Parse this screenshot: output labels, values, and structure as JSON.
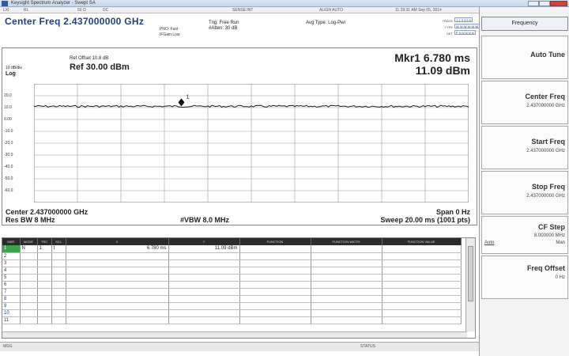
{
  "window": {
    "title": "Keysight Spectrum Analyzer - Swept SA"
  },
  "menubar": {
    "items": [
      "LXI",
      "RL",
      "",
      "50 Ω",
      "DC",
      "SENSE:INT",
      "ALIGN AUTO"
    ]
  },
  "header": {
    "center_freq_title": "Center Freq 2.437000000 GHz",
    "pno": "PNO: Fast",
    "if_gain": "IFGain:Low",
    "trig": "Trig: Free Run",
    "atten": "#Atten: 30 dB",
    "avg_type": "Avg Type: Log-Pwr",
    "timestamp": "11:29:31 AM Sep 05, 2014",
    "trace_label": "TRACE",
    "trace_value": "1 2 3 4 5 6",
    "type_label": "TYPE",
    "type_value": "W W W W W W",
    "det_label": "DET",
    "det_value": "P N N N N N"
  },
  "graph": {
    "ref_offset": "Ref Offset 10.8 dB",
    "ref_level": "Ref 30.00 dBm",
    "scale_div": "10 dB/div",
    "log_label": "Log",
    "marker_label": "Mkr1 6.780 ms",
    "marker_value": "11.09 dBm",
    "marker_tag": "1",
    "y_ticks": [
      "20.0",
      "10.0",
      "0.00",
      "-10.0",
      "-20.0",
      "-30.0",
      "-40.0",
      "-50.0",
      "-60.0"
    ],
    "center_label": "Center 2.437000000 GHz",
    "res_bw": "Res BW 8 MHz",
    "vbw": "#VBW 8.0 MHz",
    "span": "Span 0 Hz",
    "sweep": "Sweep  20.00 ms (1001 pts)"
  },
  "chart_data": {
    "type": "line",
    "title": "",
    "xlabel": "",
    "ylabel": "",
    "ylim": [
      -70,
      30
    ],
    "xlim": [
      0,
      20
    ],
    "x_unit": "ms",
    "y_unit": "dBm",
    "grid": true,
    "series": [
      {
        "level": 11.09
      }
    ],
    "marker": {
      "x": 6.78,
      "y": 11.09
    }
  },
  "marker_table": {
    "headers": [
      "MKR",
      "MODE",
      "TRC",
      "SCL",
      "X",
      "Y",
      "FUNCTION",
      "FUNCTION WIDTH",
      "FUNCTION VALUE"
    ],
    "rows": [
      {
        "num": "1",
        "mode": "N",
        "trc": "1",
        "scl": "t",
        "x": "6.780 ms",
        "y": "11.09 dBm"
      },
      {
        "num": "2"
      },
      {
        "num": "3"
      },
      {
        "num": "4"
      },
      {
        "num": "5"
      },
      {
        "num": "6"
      },
      {
        "num": "7"
      },
      {
        "num": "8"
      },
      {
        "num": "9"
      },
      {
        "num": "10"
      },
      {
        "num": "11"
      }
    ]
  },
  "statusbar": {
    "msg": "MSG",
    "status": "STATUS"
  },
  "softkeys": {
    "menu_title": "Frequency",
    "auto_tune": "Auto Tune",
    "center_freq": {
      "label": "Center Freq",
      "value": "2.437000000 GHz"
    },
    "start_freq": {
      "label": "Start Freq",
      "value": "2.437000000 GHz"
    },
    "stop_freq": {
      "label": "Stop Freq",
      "value": "2.437000000 GHz"
    },
    "cf_step": {
      "label": "CF Step",
      "value": "8.000000 MHz",
      "auto": "Auto",
      "man": "Man"
    },
    "freq_offset": {
      "label": "Freq Offset",
      "value": "0 Hz"
    }
  },
  "colors": {
    "title_blue": "#1f3f8a",
    "selected_green": "#3aa44a",
    "trace": "#1a1a1a"
  }
}
